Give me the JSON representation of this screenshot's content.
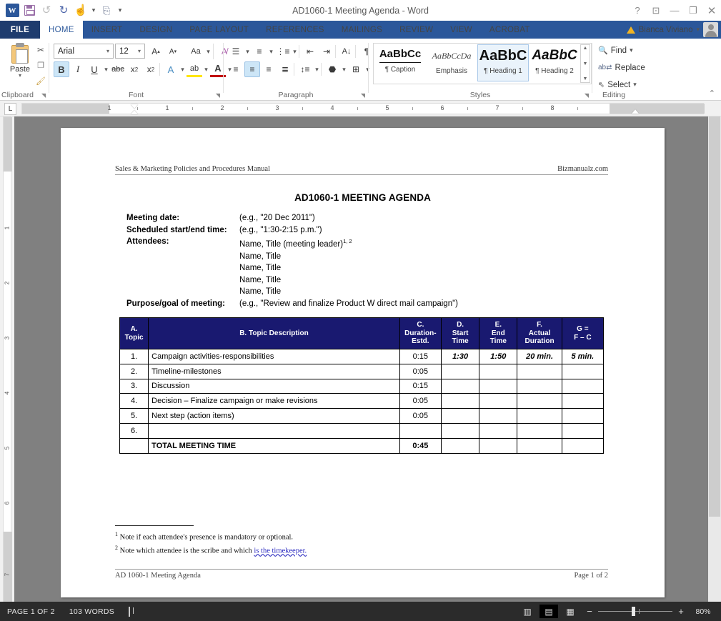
{
  "window": {
    "title": "AD1060-1 Meeting Agenda - Word",
    "quick_access": [
      "word-logo",
      "save-icon",
      "undo-icon",
      "redo-icon",
      "touch-mode-icon",
      "customize-icon",
      "qat-dropdown-icon"
    ],
    "controls": [
      "help-icon",
      "ribbon-display-options-icon",
      "minimize-icon",
      "restore-icon",
      "close-icon"
    ]
  },
  "ribbon": {
    "file_tab": "FILE",
    "tabs": [
      "HOME",
      "INSERT",
      "DESIGN",
      "PAGE LAYOUT",
      "REFERENCES",
      "MAILINGS",
      "REVIEW",
      "VIEW",
      "ACROBAT"
    ],
    "active_tab": "HOME",
    "user": "Bianca Viviano",
    "groups": {
      "clipboard": {
        "label": "Clipboard",
        "paste": "Paste",
        "buttons": [
          "cut-icon",
          "copy-icon",
          "format-painter-icon"
        ]
      },
      "font": {
        "label": "Font",
        "font_name": "Arial",
        "font_size": "12",
        "buttons": [
          "grow-font",
          "shrink-font",
          "change-case",
          "clear-formatting",
          "bold",
          "italic",
          "underline",
          "strikethrough",
          "subscript",
          "superscript",
          "text-effects",
          "text-highlight",
          "font-color"
        ],
        "active": [
          "bold"
        ]
      },
      "paragraph": {
        "label": "Paragraph",
        "buttons": [
          "bullets",
          "numbering",
          "multilevel-list",
          "decrease-indent",
          "increase-indent",
          "sort",
          "show-marks",
          "align-left",
          "align-center",
          "align-right",
          "justify",
          "line-spacing",
          "shading",
          "borders"
        ],
        "active": [
          "align-center"
        ]
      },
      "styles": {
        "label": "Styles",
        "items": [
          {
            "sample": "AaBbCc",
            "name": "¶ Caption",
            "selected": false
          },
          {
            "sample": "AaBbCcDa",
            "name": "Emphasis",
            "selected": false
          },
          {
            "sample": "AaBbC",
            "name": "¶ Heading 1",
            "selected": true
          },
          {
            "sample": "AaBbC",
            "name": "¶ Heading 2",
            "selected": false
          }
        ]
      },
      "editing": {
        "label": "Editing",
        "items": [
          {
            "label": "Find",
            "icon": "binoculars-icon",
            "has_arrow": true
          },
          {
            "label": "Replace",
            "icon": "replace-icon",
            "has_arrow": false
          },
          {
            "label": "Select",
            "icon": "select-pointer-icon",
            "has_arrow": true
          }
        ]
      }
    },
    "collapse_label": "collapse-ribbon-icon"
  },
  "ruler": {
    "horizontal_marks": [
      "1",
      "1",
      "2",
      "3",
      "4",
      "5",
      "6",
      "7",
      "8"
    ],
    "vertical_marks": [
      "1",
      "2",
      "3",
      "4",
      "5",
      "6",
      "7"
    ],
    "tab_selector": "L"
  },
  "document": {
    "header": {
      "left": "Sales & Marketing Policies and Procedures Manual",
      "right": "Bizmanualz.com"
    },
    "title": "AD1060-1 MEETING AGENDA",
    "fields": [
      {
        "label": "Meeting date:",
        "value": "(e.g., \"20 Dec 2011\")"
      },
      {
        "label": "Scheduled start/end time:",
        "value": "(e.g., \"1:30-2:15 p.m.\")"
      },
      {
        "label": "Attendees:",
        "value": "Name, Title (meeting leader)",
        "sup": "1, 2"
      },
      {
        "label": "",
        "value": "Name, Title"
      },
      {
        "label": "",
        "value": "Name, Title"
      },
      {
        "label": "",
        "value": "Name, Title"
      },
      {
        "label": "",
        "value": "Name, Title"
      },
      {
        "label": "Purpose/goal of meeting:",
        "value": "(e.g., \"Review and finalize Product W direct mail campaign\")"
      }
    ],
    "table": {
      "headers": [
        {
          "line1": "A.",
          "line2": "Topic",
          "line3": ""
        },
        {
          "line1": "B. Topic Description",
          "line2": "",
          "line3": ""
        },
        {
          "line1": "C.",
          "line2": "Duration-",
          "line3": "Estd."
        },
        {
          "line1": "D.",
          "line2": "Start",
          "line3": "Time"
        },
        {
          "line1": "E.",
          "line2": "End",
          "line3": "Time"
        },
        {
          "line1": "F.",
          "line2": "Actual",
          "line3": "Duration"
        },
        {
          "line1": "G =",
          "line2": "F – C",
          "line3": ""
        }
      ],
      "rows": [
        {
          "num": "1.",
          "desc": "Campaign activities-responsibilities",
          "dur": "0:15",
          "start": "1:30",
          "end": "1:50",
          "actual": "20 min.",
          "gc": "5 min.",
          "example": true
        },
        {
          "num": "2.",
          "desc": "Timeline-milestones",
          "dur": "0:05",
          "start": "",
          "end": "",
          "actual": "",
          "gc": "",
          "example": false
        },
        {
          "num": "3.",
          "desc": "Discussion",
          "dur": "0:15",
          "start": "",
          "end": "",
          "actual": "",
          "gc": "",
          "example": false
        },
        {
          "num": "4.",
          "desc": "Decision – Finalize campaign or make revisions",
          "dur": "0:05",
          "start": "",
          "end": "",
          "actual": "",
          "gc": "",
          "example": false
        },
        {
          "num": "5.",
          "desc": "Next step (action items)",
          "dur": "0:05",
          "start": "",
          "end": "",
          "actual": "",
          "gc": "",
          "example": false
        },
        {
          "num": "6.",
          "desc": "",
          "dur": "",
          "start": "",
          "end": "",
          "actual": "",
          "gc": "",
          "example": false
        }
      ],
      "total": {
        "num": "",
        "desc": "TOTAL MEETING TIME",
        "dur": "0:45",
        "start": "",
        "end": "",
        "actual": "",
        "gc": ""
      },
      "header_color": "#191970"
    },
    "footnotes": [
      {
        "marker": "1",
        "text": "Note if each attendee's presence is mandatory or optional."
      },
      {
        "marker": "2",
        "text": "Note which attendee is the scribe and which ",
        "link": "is the timekeeper."
      }
    ],
    "footer": {
      "left": "AD 1060-1 Meeting Agenda",
      "right": "Page 1 of 2"
    }
  },
  "status_bar": {
    "page": "PAGE 1 OF 2",
    "words": "103 WORDS",
    "proofing_icon": "proofing-errors-icon",
    "views": [
      {
        "name": "read-mode-view",
        "active": false
      },
      {
        "name": "print-layout-view",
        "active": true
      },
      {
        "name": "web-layout-view",
        "active": false
      }
    ],
    "zoom_out": "−",
    "zoom_in": "+",
    "zoom_level": "80%"
  }
}
